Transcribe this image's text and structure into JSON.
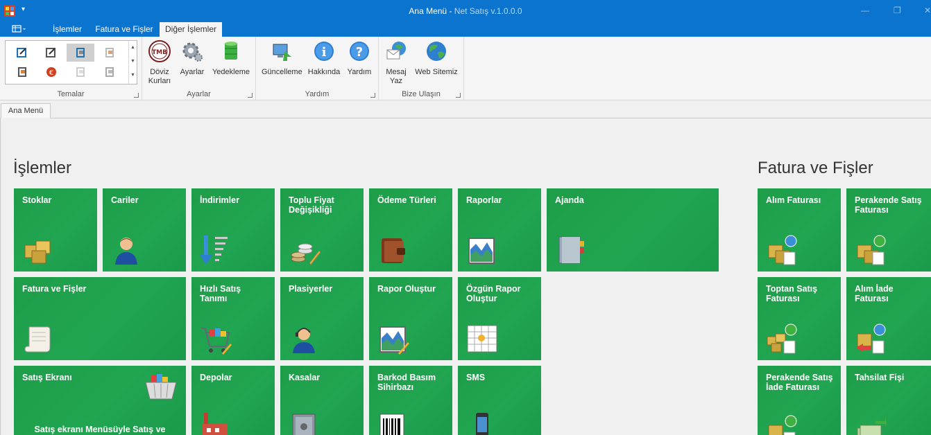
{
  "window": {
    "title": "Ana Menü",
    "subtitle": "Net Satış v.1.0.0.0",
    "qat_symbol": "▾",
    "minimize": "—",
    "maximize": "❐",
    "close": "✕"
  },
  "ribbon": {
    "tabs": [
      "İşlemler",
      "Fatura ve Fişler",
      "Diğer İşlemler"
    ],
    "active_tab": "Diğer İşlemler",
    "groups": {
      "temalar": {
        "label": "Temalar"
      },
      "ayarlar": {
        "label": "Ayarlar",
        "buttons": [
          "Döviz Kurları",
          "Ayarlar",
          "Yedekleme"
        ]
      },
      "yardim": {
        "label": "Yardım",
        "buttons": [
          "Güncelleme",
          "Hakkında",
          "Yardım"
        ]
      },
      "bize": {
        "label": "Bize Ulaşın",
        "buttons": [
          "Mesaj Yaz",
          "Web Sitemiz"
        ]
      }
    },
    "doviz_l1": "Döviz",
    "doviz_l2": "Kurları",
    "mesaj_l1": "Mesaj",
    "mesaj_l2": "Yaz",
    "tmb_text": "TMB"
  },
  "doc_tab": "Ana Menü",
  "sections": {
    "islemler": "İşlemler",
    "fatura": "Fatura ve Fişler"
  },
  "tiles": {
    "stoklar": "Stoklar",
    "cariler": "Cariler",
    "indirimler": "İndirimler",
    "toplu": "Toplu Fiyat Değişikliği",
    "odeme": "Ödeme Türleri",
    "raporlar": "Raporlar",
    "ajanda": "Ajanda",
    "fatura_fisler": "Fatura ve Fişler",
    "hizli": "Hızlı Satış Tanımı",
    "plasiyerler": "Plasiyerler",
    "rapor_olustur": "Rapor Oluştur",
    "ozgun": "Özgün Rapor Oluştur",
    "satis_ekrani": "Satış Ekranı",
    "satis_sub": "Satış ekranı Menüsüyle Satış ve",
    "depolar": "Depolar",
    "kasalar": "Kasalar",
    "barkod": "Barkod Basım Sihirbazı",
    "sms": "SMS",
    "alim_faturasi": "Alım Faturası",
    "perakende_satis": "Perakende Satış Faturası",
    "toptan": "Toptan Satış Faturası",
    "alim_iade": "Alım İade Faturası",
    "perakende_iade": "Perakende Satış İade Faturası",
    "tahsilat": "Tahsilat Fişi"
  },
  "colors": {
    "titlebar": "#0a74cf",
    "tile_green": "#21a551",
    "ribbon_bg": "#f5f5f5"
  }
}
